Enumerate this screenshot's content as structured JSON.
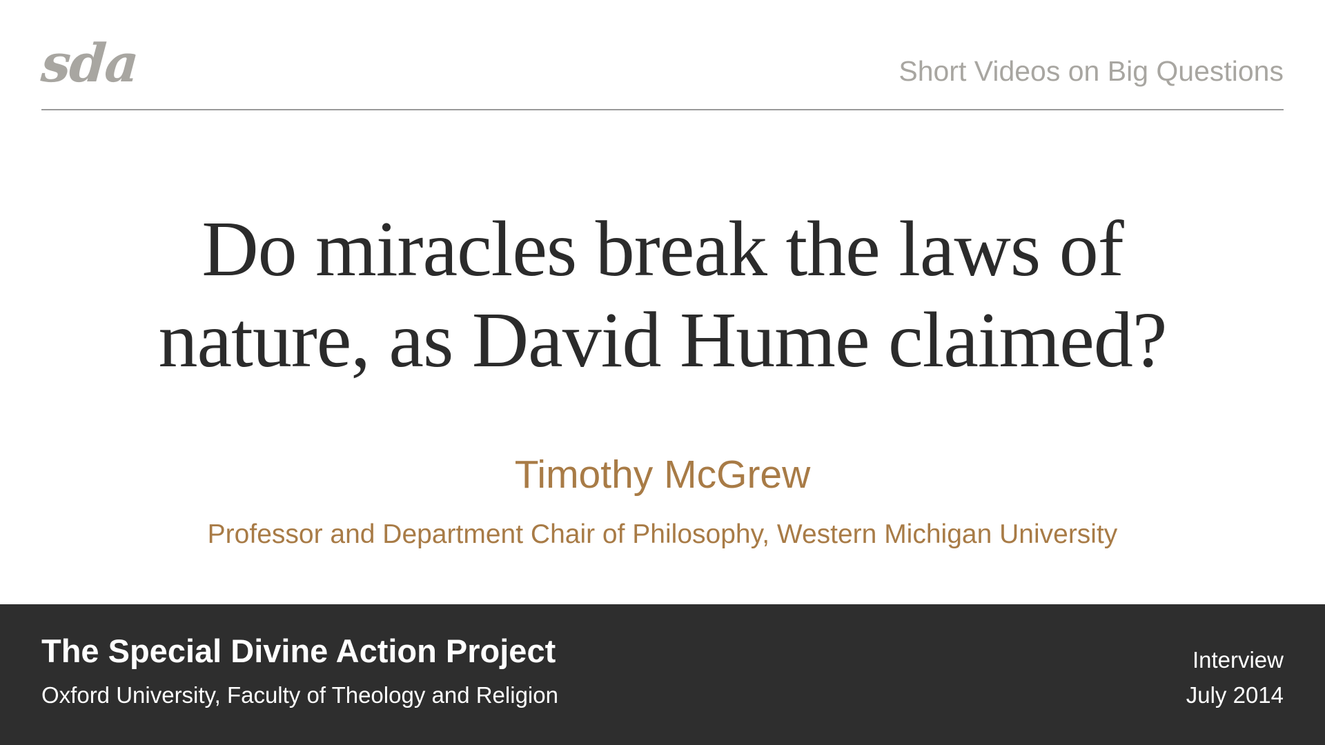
{
  "header": {
    "logo_text": "sda",
    "tagline": "Short Videos on Big Questions"
  },
  "main": {
    "title_line1": "Do miracles break the laws of",
    "title_line2": "nature, as David Hume claimed?",
    "speaker_name": "Timothy McGrew",
    "speaker_role": "Professor and Department Chair of Philosophy, Western Michigan University"
  },
  "footer": {
    "project_name": "The Special Divine Action Project",
    "institution": "Oxford University, Faculty of Theology and Religion",
    "format": "Interview",
    "date": "July 2014"
  },
  "colors": {
    "background": "#ffffff",
    "header_gray": "#a8a6a1",
    "title_text": "#2b2b2b",
    "accent_brown": "#a87b46",
    "footer_background": "#2e2e2e",
    "footer_text": "#ffffff"
  }
}
